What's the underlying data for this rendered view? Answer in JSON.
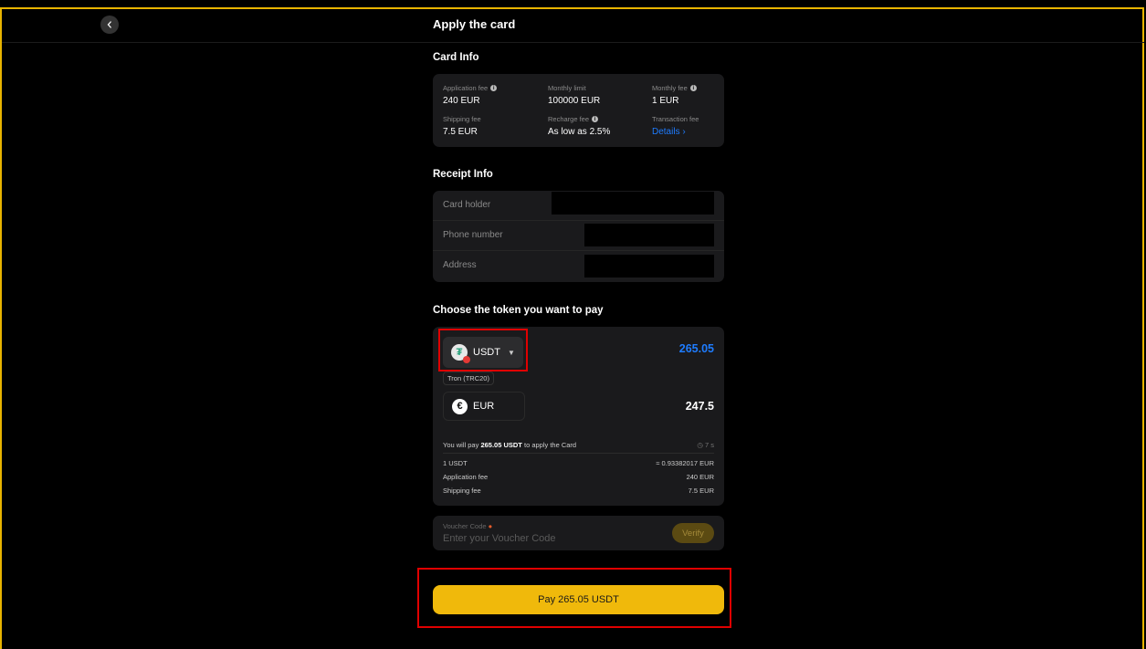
{
  "header": {
    "title": "Apply the card"
  },
  "card_info": {
    "title": "Card Info",
    "fees": [
      {
        "label": "Application fee",
        "value": "240 EUR",
        "info": true
      },
      {
        "label": "Monthly limit",
        "value": "100000 EUR",
        "info": false
      },
      {
        "label": "Monthly fee",
        "value": "1 EUR",
        "info": true
      },
      {
        "label": "Shipping fee",
        "value": "7.5 EUR",
        "info": false
      },
      {
        "label": "Recharge fee",
        "value": "As low as 2.5%",
        "info": true
      },
      {
        "label": "Transaction fee",
        "value": "Details ›",
        "info": false
      }
    ]
  },
  "receipt_info": {
    "title": "Receipt Info",
    "rows": [
      {
        "label": "Card holder"
      },
      {
        "label": "Phone number"
      },
      {
        "label": "Address"
      }
    ]
  },
  "payment": {
    "title": "Choose the token you want to pay",
    "token": "USDT",
    "network": "Tron (TRC20)",
    "token_amount": "265.05",
    "currency": "EUR",
    "currency_amount": "247.5",
    "pay_line_prefix": "You will pay",
    "pay_line_amount": "265.05 USDT",
    "pay_line_suffix": "to apply the Card",
    "timer": "7 s",
    "rows": [
      {
        "label": "1 USDT",
        "value": "≈ 0.93382017 EUR"
      },
      {
        "label": "Application fee",
        "value": "240 EUR"
      },
      {
        "label": "Shipping fee",
        "value": "7.5 EUR"
      }
    ]
  },
  "voucher": {
    "label": "Voucher Code",
    "placeholder": "Enter your Voucher Code",
    "verify_label": "Verify"
  },
  "pay_button": {
    "label": "Pay 265.05 USDT"
  },
  "colors": {
    "accent": "#f0b90b",
    "link": "#1e7cff",
    "highlight": "#e00000"
  },
  "icons": [
    "back-arrow-icon",
    "info-icon",
    "tether-icon",
    "chevron-down-icon",
    "euro-icon",
    "clock-icon",
    "gift-icon"
  ]
}
